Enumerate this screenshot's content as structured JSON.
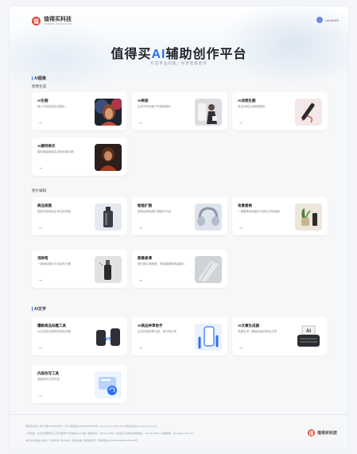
{
  "header": {
    "logo_mark": "值",
    "logo_name": "值得买科技",
    "logo_sub": "ZHIDEMAI TECHNOLOGY",
    "user_name": "user6389"
  },
  "hero": {
    "title_before": "值得买",
    "title_ai": "AI",
    "title_after": "辅助创作平台",
    "subtitle": "打造专业内容，尽享智能创作"
  },
  "sections": {
    "image": {
      "title": "AI图像"
    },
    "text": {
      "title": "AI文字"
    }
  },
  "groups": {
    "image_gen": "图像生成",
    "image_edit": "图片编辑"
  },
  "cards": [
    {
      "title": "AI生图",
      "desc": "输入内容描述生成图片...",
      "thumb": "portrait-woman"
    },
    {
      "title": "AI换装",
      "desc": "生成不同场景下的服装图片",
      "thumb": "outfit-model"
    },
    {
      "title": "AI涂鸦生图",
      "desc": "自由涂鸦生成精美图片",
      "thumb": "pen-drawing"
    },
    {
      "title": "AI模特换衣",
      "desc": "模特服装换装生成商品展示图",
      "thumb": "model-fashion"
    },
    {
      "title": "商品抠图",
      "desc": "智能识别商品主体去除背景",
      "thumb": "perfume-bottle"
    },
    {
      "title": "智能扩图",
      "desc": "智能延伸画面扩展图片内容",
      "thumb": "headphones"
    },
    {
      "title": "背景替换",
      "desc": "一键替换商品图片背景生成场景图",
      "thumb": "plant-pot"
    },
    {
      "title": "消除笔",
      "desc": "一键消除图片中多余的元素",
      "thumb": "bottle-eraser"
    },
    {
      "title": "图像高清",
      "desc": "提升图片清晰度，修复模糊低质量图片",
      "thumb": "hd-lines"
    },
    {
      "title": "爆款商品标题工具",
      "desc": "AI生成吸引眼球的商品标题",
      "thumb": "products-vs"
    },
    {
      "title": "AI商品种草助手",
      "desc": "生成优质种草文案，提升转化率",
      "thumb": "phone-earbuds"
    },
    {
      "title": "AI文章生成器",
      "desc": "快速生成一篇高质量的原创文章",
      "thumb": "typewriter"
    },
    {
      "title": "内容改写工具",
      "desc": "智能改写文章内容",
      "thumb": "rewrite-doc"
    }
  ],
  "arrow": "→",
  "footer": {
    "line1": "值得买科技 | 京ICP备13009594号-1 | 京公网安备11010502025612号 | Copyright © 2011-2024 值得买科技 All rights reserved.",
    "line2": "公司地址：北京市朝阳区东三环北路甲19号嘉盛中心22层 | 客服电话：400-011-8386 | 违法和不良信息举报电话：400-011-8386 | 举报邮箱：jubao@smzdm.com",
    "line3": "本平台内容由AI生成，仅供参考 | 用户协议 | 隐私政策 | 算法备案号：网信算备110105838468201230015号",
    "logo_mark": "值",
    "logo_name": "值得买科技"
  }
}
